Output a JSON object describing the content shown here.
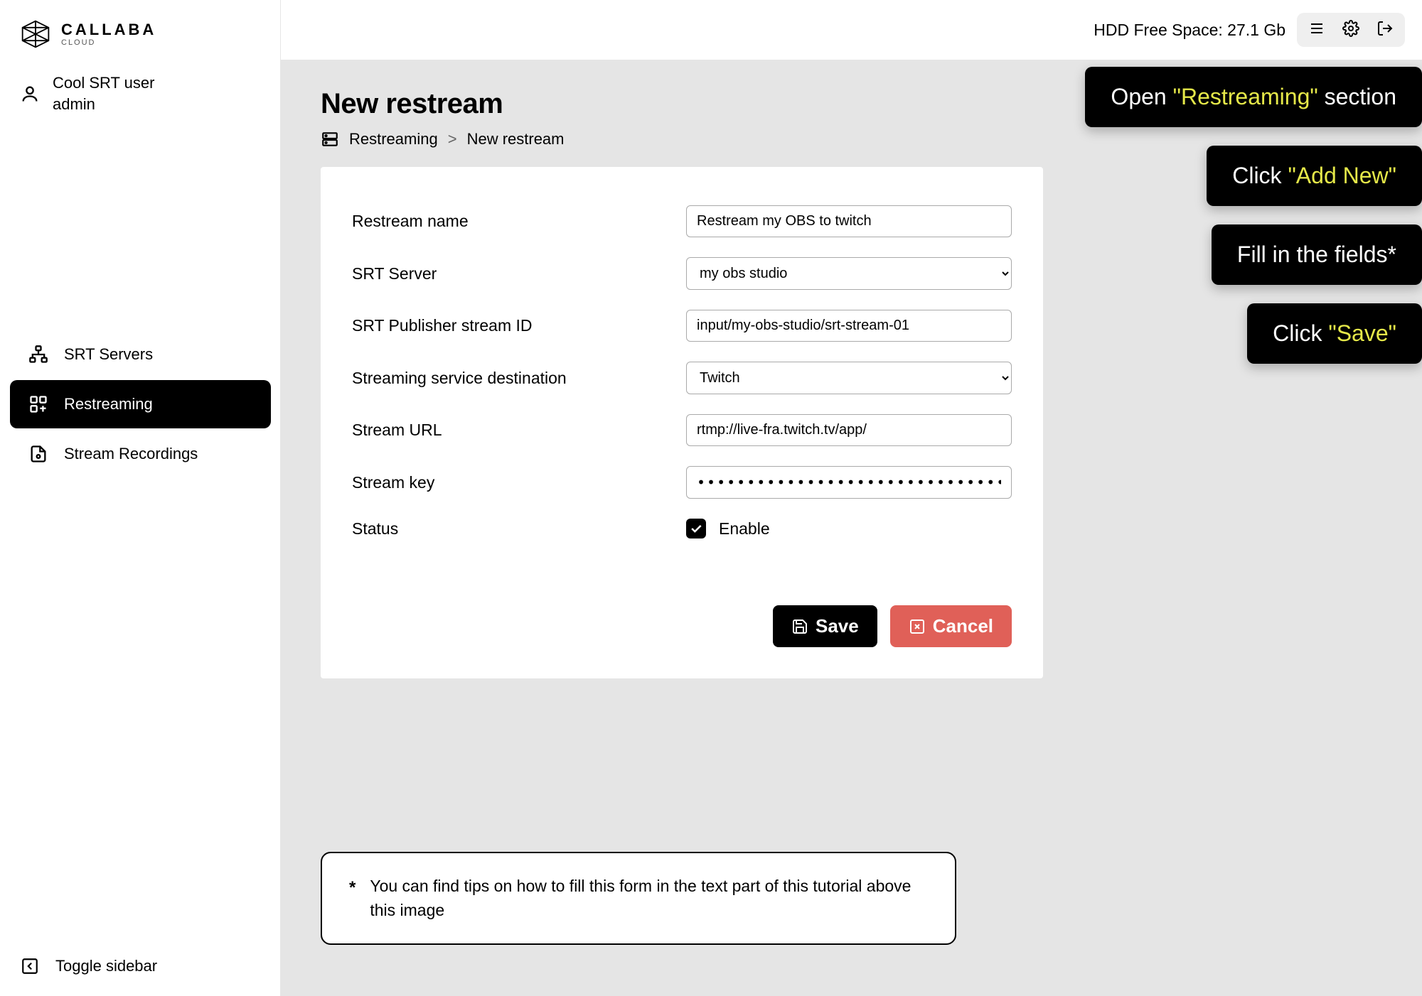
{
  "brand": {
    "title": "CALLABA",
    "subtitle": "CLOUD"
  },
  "user": {
    "name": "Cool SRT user",
    "role": "admin"
  },
  "nav": {
    "items": [
      {
        "label": "SRT Servers"
      },
      {
        "label": "Restreaming"
      },
      {
        "label": "Stream Recordings"
      }
    ]
  },
  "sidebar_toggle": "Toggle sidebar",
  "topbar": {
    "free_space": "HDD Free Space: 27.1 Gb"
  },
  "page": {
    "title": "New restream",
    "breadcrumb": {
      "a": "Restreaming",
      "sep": ">",
      "b": "New restream"
    }
  },
  "form": {
    "labels": {
      "name": "Restream name",
      "server": "SRT Server",
      "publisher": "SRT Publisher stream ID",
      "destination": "Streaming service destination",
      "url": "Stream URL",
      "key": "Stream key",
      "status": "Status"
    },
    "values": {
      "name": "Restream my OBS to twitch",
      "server": "my obs studio",
      "publisher": "input/my-obs-studio/srt-stream-01",
      "destination": "Twitch",
      "url": "rtmp://live-fra.twitch.tv/app/",
      "key": "•••••••••••••••••••••••••••••••••••••••••••••|"
    },
    "enable_label": "Enable",
    "enabled": true,
    "buttons": {
      "save": "Save",
      "cancel": "Cancel"
    }
  },
  "tip": {
    "star": "*",
    "text": "You can find tips on how to fill this form in the text part of this tutorial above this image"
  },
  "callouts": [
    {
      "pre": "Open ",
      "hl": "\"Restreaming\"",
      "post": " section"
    },
    {
      "pre": "Click ",
      "hl": "\"Add New\"",
      "post": ""
    },
    {
      "pre": "Fill in the fields*",
      "hl": "",
      "post": ""
    },
    {
      "pre": "Click ",
      "hl": "\"Save\"",
      "post": ""
    }
  ]
}
